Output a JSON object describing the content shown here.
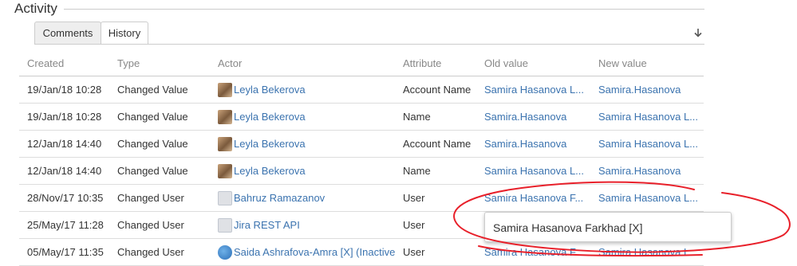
{
  "section": {
    "title": "Activity"
  },
  "tabs": [
    {
      "label": "Comments",
      "active": false
    },
    {
      "label": "History",
      "active": true
    }
  ],
  "sort_icon": "arrow-down-icon",
  "table": {
    "columns": [
      "Created",
      "Type",
      "Actor",
      "Attribute",
      "Old value",
      "New value"
    ],
    "rows": [
      {
        "created": "19/Jan/18 10:28",
        "type": "Changed Value",
        "actor": "Leyla Bekerova",
        "avatar": "photo",
        "attribute": "Account Name",
        "old_value": "Samira Hasanova L...",
        "new_value": "Samira.Hasanova"
      },
      {
        "created": "19/Jan/18 10:28",
        "type": "Changed Value",
        "actor": "Leyla Bekerova",
        "avatar": "photo",
        "attribute": "Name",
        "old_value": "Samira.Hasanova",
        "new_value": "Samira Hasanova L..."
      },
      {
        "created": "12/Jan/18 14:40",
        "type": "Changed Value",
        "actor": "Leyla Bekerova",
        "avatar": "photo",
        "attribute": "Account Name",
        "old_value": "Samira.Hasanova",
        "new_value": "Samira Hasanova L..."
      },
      {
        "created": "12/Jan/18 14:40",
        "type": "Changed Value",
        "actor": "Leyla Bekerova",
        "avatar": "photo",
        "attribute": "Name",
        "old_value": "Samira Hasanova L...",
        "new_value": "Samira.Hasanova"
      },
      {
        "created": "28/Nov/17 10:35",
        "type": "Changed User",
        "actor": "Bahruz Ramazanov",
        "avatar": "default",
        "attribute": "User",
        "old_value": "Samira Hasanova F...",
        "new_value": "Samira Hasanova L..."
      },
      {
        "created": "25/May/17 11:28",
        "type": "Changed User",
        "actor": "Jira REST API",
        "avatar": "default",
        "attribute": "User",
        "old_value": "",
        "new_value": ""
      },
      {
        "created": "05/May/17 11:35",
        "type": "Changed User",
        "actor": "Saida Ashrafova-Amra [X] (Inactive)",
        "avatar": "globe",
        "attribute": "User",
        "old_value": "Samira Hasanova F...",
        "new_value": "Samira Hasanova L..."
      }
    ]
  },
  "tooltip": {
    "text": "Samira Hasanova Farkhad [X]"
  },
  "annotation": {
    "color": "#e8202a"
  }
}
